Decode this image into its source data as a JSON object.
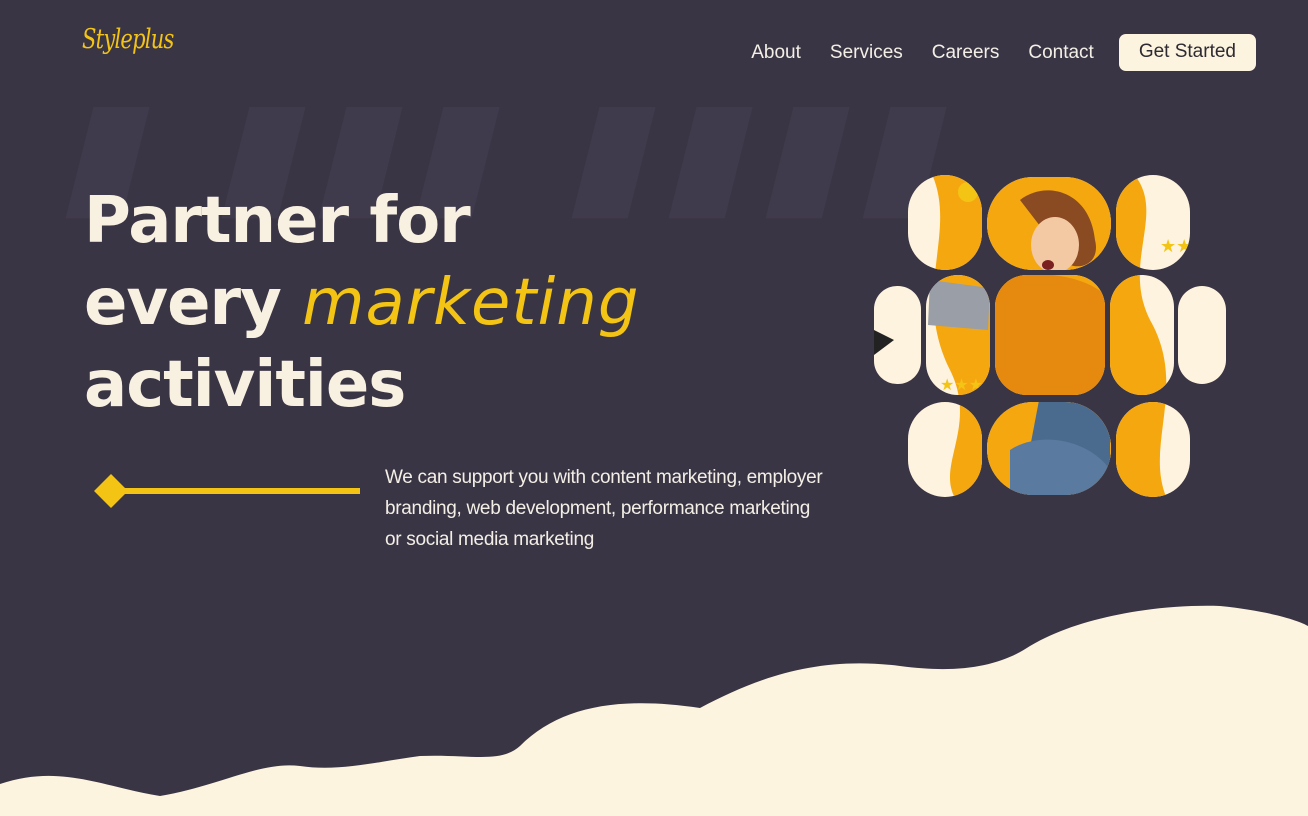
{
  "brand": {
    "logo_text": "Styleplus"
  },
  "nav": {
    "links": [
      "About",
      "Services",
      "Careers",
      "Contact"
    ],
    "cta_label": "Get Started"
  },
  "hero": {
    "title_line1": "Partner for",
    "title_word": "every",
    "title_accent": "marketing",
    "title_line3": "activities",
    "description": "We can support you with content marketing, employer branding, web development, performance marketing or social media marketing"
  },
  "colors": {
    "background": "#3a3545",
    "accent": "#f3c414",
    "cream": "#fdf4df",
    "text": "#f8f1e2"
  }
}
